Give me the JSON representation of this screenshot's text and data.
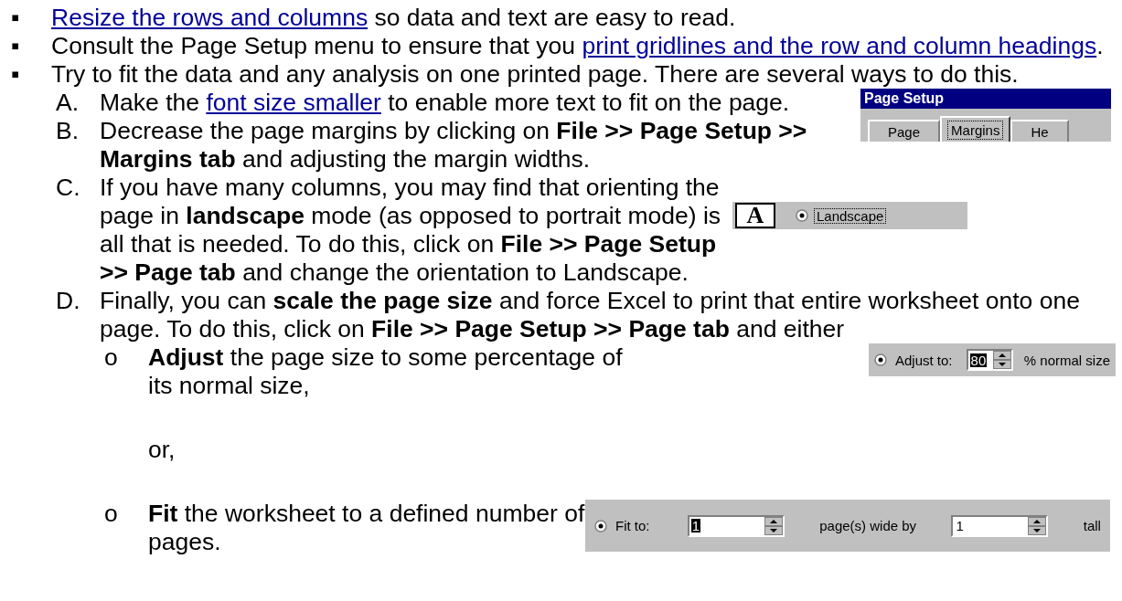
{
  "items": [
    {
      "marker": "▪",
      "segments": [
        {
          "kind": "link",
          "text": "Resize the rows and columns"
        },
        {
          "kind": "text",
          "text": " so data and text are easy to read."
        }
      ]
    },
    {
      "marker": "▪",
      "segments": [
        {
          "kind": "text",
          "text": "Consult the Page Setup menu to ensure that you "
        },
        {
          "kind": "link",
          "text": "print gridlines and the row and column headings"
        },
        {
          "kind": "text",
          "text": "."
        }
      ]
    },
    {
      "marker": "▪",
      "segments": [
        {
          "kind": "text",
          "text": "Try to fit the data and any analysis on one printed page. There are several ways to do this."
        }
      ],
      "children": [
        {
          "marker": "A.",
          "segments": [
            {
              "kind": "text",
              "text": "Make the "
            },
            {
              "kind": "link",
              "text": "font size smaller"
            },
            {
              "kind": "text",
              "text": " to enable more text to fit on the page."
            }
          ],
          "figure": {
            "kind": "dialog_header",
            "title": "Page Setup",
            "tabs": [
              {
                "label": "Page",
                "selected": false
              },
              {
                "label": "Margins",
                "selected": true
              },
              {
                "label": "He",
                "selected": false
              }
            ]
          }
        },
        {
          "marker": "B.",
          "segments": [
            {
              "kind": "text",
              "text": "Decrease the page margins by clicking on **File >> Page Setup >> Margins tab** and adjusting the margin widths."
            }
          ]
        },
        {
          "marker": "C.",
          "segments": [
            {
              "kind": "text",
              "text": "If you have many columns, you may find that orienting the page in **landscape** mode (as opposed to portrait mode) is all that is needed. To do this, click on **File >> Page Setup >> Page tab** and change the orientation to Landscape."
            }
          ],
          "figure": {
            "kind": "orientation",
            "controls": [
              {
                "kind": "page_icon",
                "text": "A"
              },
              {
                "kind": "radio",
                "label": "Landscape",
                "selected": true,
                "focused": true
              }
            ]
          }
        },
        {
          "marker": "D.",
          "segments": [
            {
              "kind": "text",
              "text": "Finally, you can **scale the page size** and force Excel to print that entire worksheet onto one page. To do this, click on **File >> Page Setup >> Page tab** and either"
            }
          ],
          "children": [
            {
              "kind": "bullet",
              "marker": "o",
              "segments": [
                {
                  "kind": "text",
                  "text": "**Adjust** the page size to some percentage of its normal size,"
                }
              ],
              "figure": {
                "kind": "adjust",
                "controls": [
                  {
                    "kind": "radio",
                    "label": "Adjust to:",
                    "selected": true,
                    "focused": false
                  },
                  {
                    "kind": "spin",
                    "value": "80",
                    "highlighted": true
                  },
                  {
                    "kind": "label",
                    "text": "% normal size"
                  }
                ]
              }
            },
            {
              "kind": "note",
              "segments": [
                {
                  "kind": "text",
                  "text": "or,"
                }
              ]
            },
            {
              "kind": "bullet",
              "marker": "o",
              "segments": [
                {
                  "kind": "text",
                  "text": "**Fit** the worksheet to a defined number of pages."
                }
              ],
              "figure": {
                "kind": "fit",
                "controls": [
                  {
                    "kind": "radio",
                    "label": "Fit to:",
                    "selected": true,
                    "focused": false
                  },
                  {
                    "kind": "spin",
                    "value": "1",
                    "highlighted": true
                  },
                  {
                    "kind": "label",
                    "text": "page(s) wide by"
                  },
                  {
                    "kind": "spin",
                    "value": "1",
                    "highlighted": false
                  },
                  {
                    "kind": "label",
                    "text": "tall"
                  }
                ]
              }
            }
          ]
        }
      ]
    }
  ]
}
